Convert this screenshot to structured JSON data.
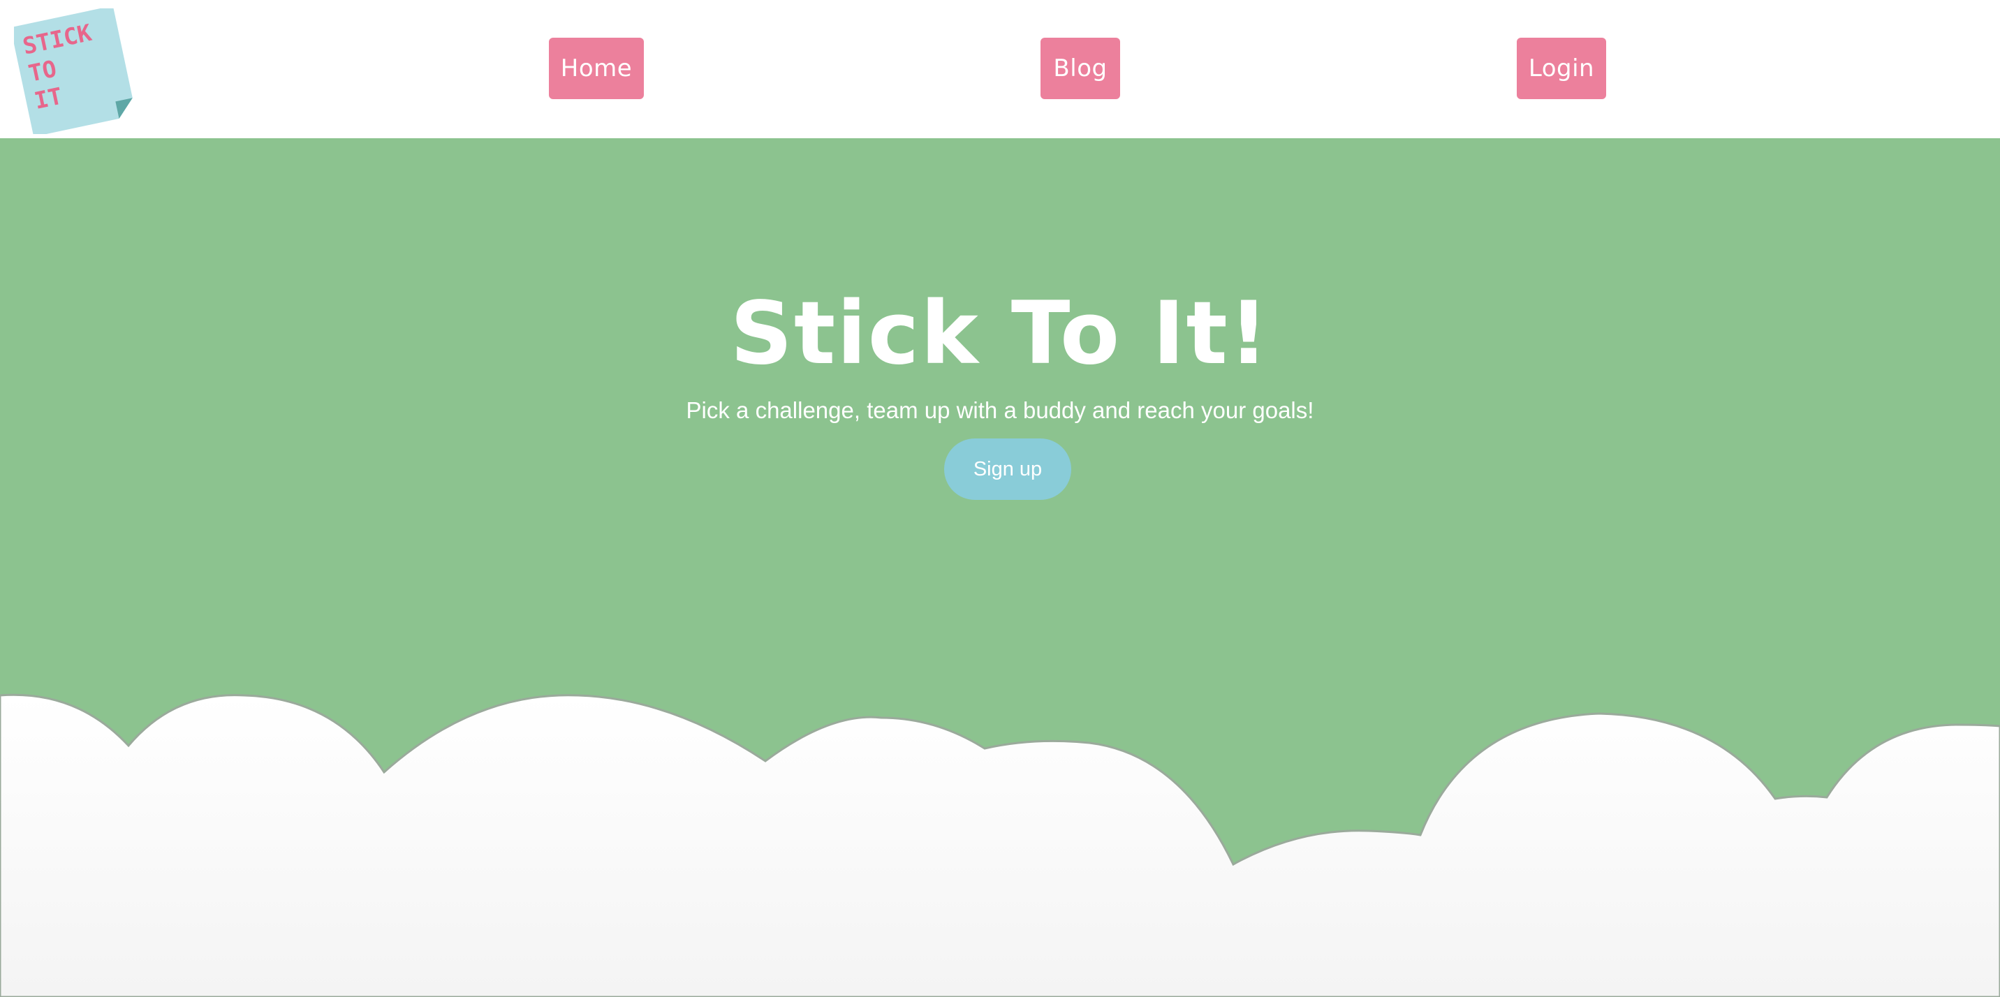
{
  "logo": {
    "lines": [
      "STICK",
      "TO",
      "IT"
    ],
    "note_color": "#b3dfe6",
    "fold_color": "#5ea7a6",
    "text_color": "#e7668b"
  },
  "nav": {
    "home_label": "Home",
    "blog_label": "Blog",
    "login_label": "Login",
    "button_color": "#ec809c"
  },
  "hero": {
    "title": "Stick To It!",
    "tagline": "Pick a challenge, team up with a buddy and reach your goals!",
    "signup_label": "Sign up",
    "background_color": "#8cc38f",
    "signup_color": "#89ccd8"
  }
}
